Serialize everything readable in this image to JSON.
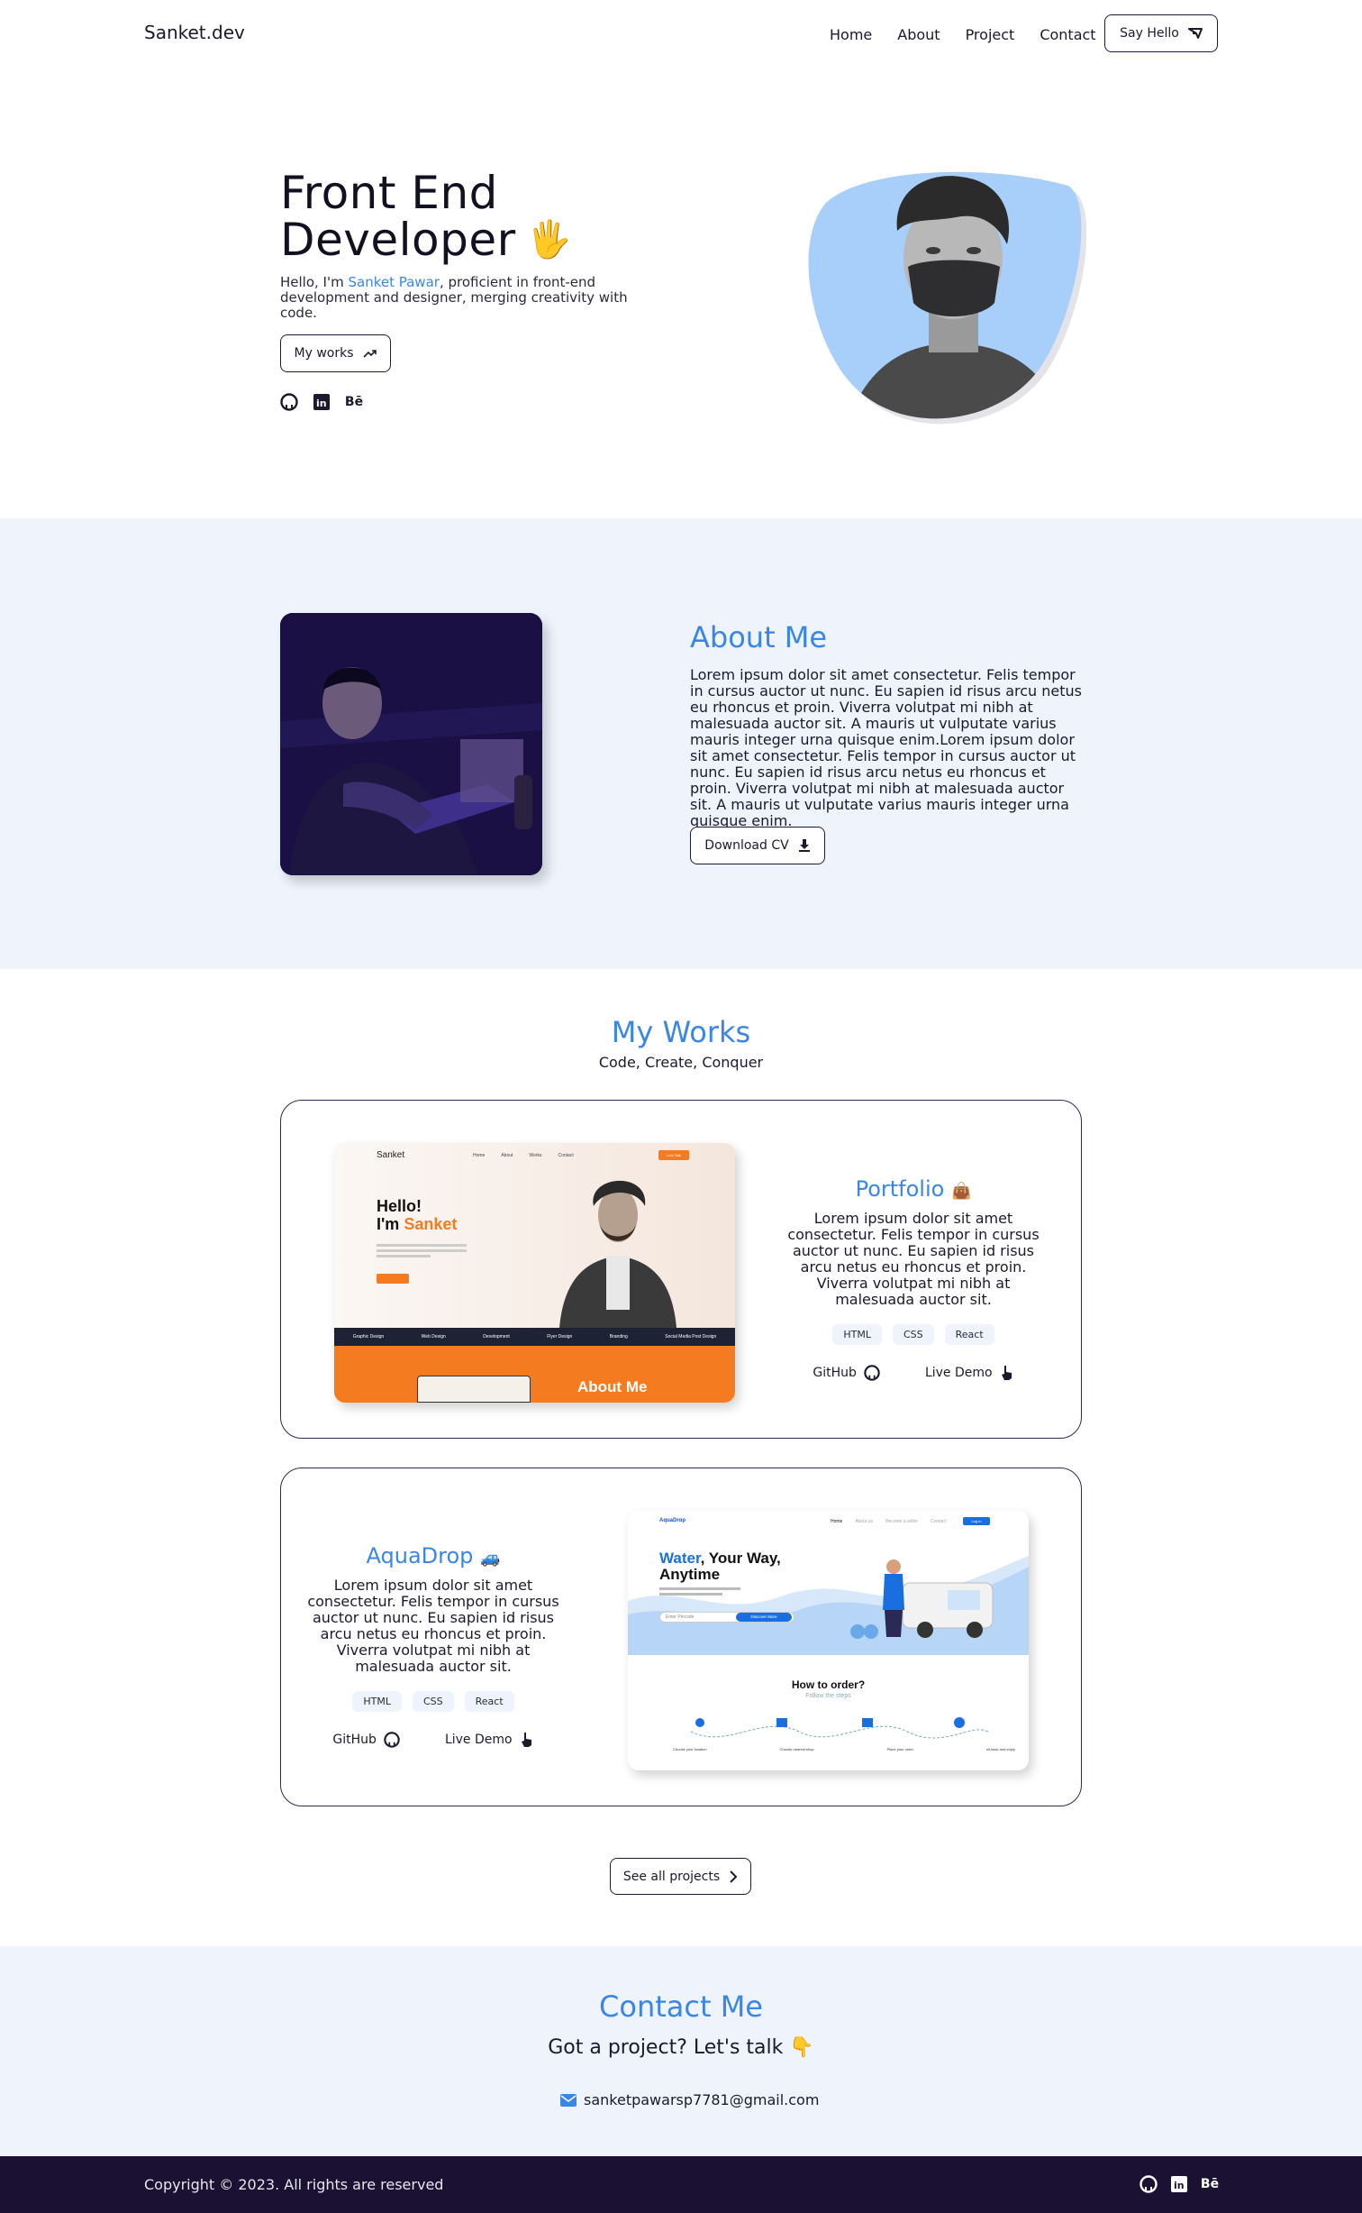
{
  "nav": {
    "logo": "Sanket.dev",
    "links": [
      "Home",
      "About",
      "Project",
      "Contact"
    ],
    "cta": "Say Hello"
  },
  "hero": {
    "title_line1": "Front End",
    "title_line2": "Developer",
    "wave_emoji": "🖐",
    "intro_prefix": "Hello, I'm ",
    "intro_name": "Sanket Pawar",
    "intro_suffix": ", proficient in front-end development and designer, merging creativity with code.",
    "works_button": "My works",
    "socials": [
      "github-icon",
      "linkedin-icon",
      "behance-icon"
    ],
    "behance_label": "Bē",
    "blob_color": "#a7cff9"
  },
  "about": {
    "heading": "About Me",
    "text": "Lorem ipsum dolor sit amet consectetur. Felis tempor in cursus auctor ut nunc. Eu sapien id risus arcu netus eu rhoncus et proin. Viverra volutpat mi nibh at malesuada auctor sit. A mauris ut vulputate varius mauris integer urna quisque enim.Lorem ipsum dolor sit amet consectetur. Felis tempor in cursus auctor ut nunc. Eu sapien id risus arcu netus eu rhoncus et proin. Viverra volutpat mi nibh at malesuada auctor sit. A mauris ut vulputate varius mauris integer urna quisque enim.",
    "cv_button": "Download CV"
  },
  "works": {
    "heading": "My Works",
    "subheading": "Code, Create, Conquer",
    "projects": [
      {
        "title": "Portfolio",
        "emoji": "👜",
        "description": "Lorem ipsum dolor sit amet consectetur. Felis tempor in cursus auctor ut nunc. Eu sapien id risus arcu netus eu rhoncus et proin. Viverra volutpat mi nibh at malesuada auctor sit.",
        "tags": [
          "HTML",
          "CSS",
          "React"
        ],
        "github": "GitHub",
        "demo": "Live Demo",
        "preview": {
          "brand": "Sanket",
          "nav": [
            "Home",
            "About",
            "Works",
            "Contact"
          ],
          "cta": "Lets Talk",
          "hello": "Hello!",
          "im": "I'm",
          "name": "Sanket",
          "strip": [
            "Graphic Design",
            "Web Design",
            "Development",
            "Flyer Design",
            "Branding",
            "Social Media Post Design"
          ],
          "about": "About Me"
        }
      },
      {
        "title": "AquaDrop",
        "emoji": "🚙",
        "description": "Lorem ipsum dolor sit amet consectetur. Felis tempor in cursus auctor ut nunc. Eu sapien id risus arcu netus eu rhoncus et proin. Viverra volutpat mi nibh at malesuada auctor sit.",
        "tags": [
          "HTML",
          "CSS",
          "React"
        ],
        "github": "GitHub",
        "demo": "Live Demo",
        "preview": {
          "brand": "AquaDrop",
          "nav": [
            "Home",
            "About us",
            "Become a seller",
            "Contact"
          ],
          "login": "Log In",
          "headline_blue": "Water",
          "headline_rest": ", Your Way,",
          "headline_line2": "Anytime",
          "input_placeholder": "Enter Pincode",
          "discover": "Discover More",
          "how": "How to order?",
          "follow": "Follow the steps",
          "steps": [
            "Choose your location",
            "Choose nearest shop",
            "Place your order",
            "sit back and enjoy"
          ]
        }
      }
    ],
    "see_all": "See all projects"
  },
  "contact": {
    "heading": "Contact Me",
    "tagline": "Got a project? Let's talk",
    "tagline_emoji": "👇",
    "email": "sanketpawarsp7781@gmail.com"
  },
  "footer": {
    "copyright": "Copyright © 2023. All rights are reserved",
    "behance_label": "Bē"
  },
  "colors": {
    "accent": "#3a86e8",
    "section_bg": "#eef3fc",
    "footer_bg": "#1b1233",
    "orange": "#f47b20"
  }
}
